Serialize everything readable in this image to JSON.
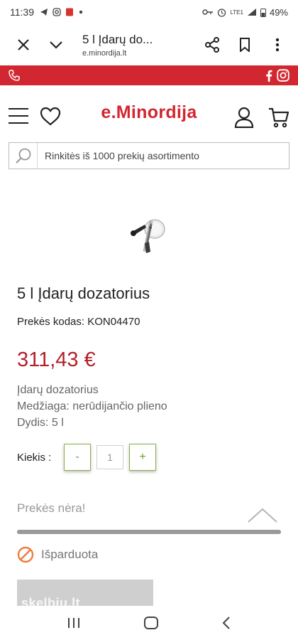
{
  "status_bar": {
    "time": "11:39",
    "battery": "49%",
    "network_label": "LTE1"
  },
  "browser": {
    "page_title": "5 l Įdarų do...",
    "url": "e.minordija.lt"
  },
  "site": {
    "logo": "e.Minordija",
    "search_placeholder": "Rinkitės iš 1000 prekių asortimento"
  },
  "product": {
    "title": "5 l Įdarų dozatorius",
    "code_line": "Prekės kodas: KON04470",
    "price": "311,43 €",
    "features": [
      "Įdarų dozatorius",
      "Medžiaga: nerūdijančio plieno",
      "Dydis: 5 l"
    ],
    "quantity_label": "Kiekis :",
    "quantity_value": "1",
    "minus_label": "-",
    "plus_label": "+",
    "availability": "Prekės nėra!",
    "sold_out": "Išparduota"
  },
  "watermark": "skelbiu.lt",
  "colors": {
    "brand_red": "#d22630",
    "price_red": "#b3202a",
    "qty_green": "#6e9a2e"
  }
}
